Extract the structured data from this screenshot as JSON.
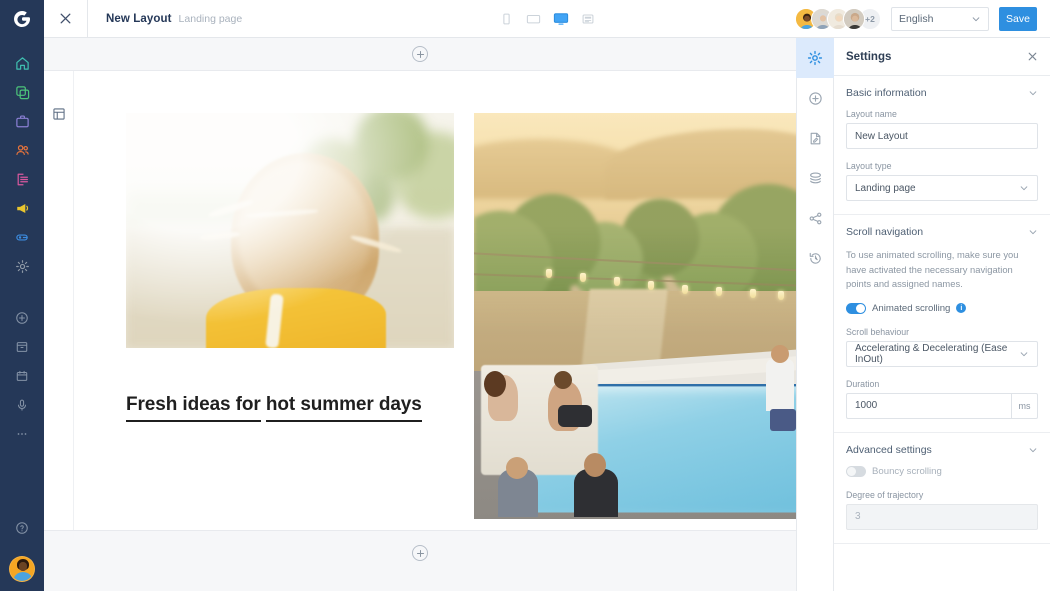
{
  "nav": {
    "logo": "app-logo",
    "items": [
      {
        "name": "home",
        "label": "Home",
        "color": "#3fbfb0"
      },
      {
        "name": "pages",
        "label": "Pages",
        "color": "#4cc47a"
      },
      {
        "name": "projects",
        "label": "Projects",
        "color": "#8a7fd4"
      },
      {
        "name": "contacts",
        "label": "Contacts",
        "color": "#e8743b"
      },
      {
        "name": "forms",
        "label": "Forms",
        "color": "#d9589e"
      },
      {
        "name": "campaigns",
        "label": "Campaigns",
        "color": "#e8c52e"
      },
      {
        "name": "integrations",
        "label": "Integrations",
        "color": "#3c8ce0"
      },
      {
        "name": "settings",
        "label": "Settings",
        "color": "#8e99a6"
      }
    ],
    "tools": [
      {
        "name": "add",
        "label": "Add"
      },
      {
        "name": "archive",
        "label": "Archive"
      },
      {
        "name": "calendar",
        "label": "Calendar"
      },
      {
        "name": "microphone",
        "label": "Voice"
      },
      {
        "name": "more",
        "label": "More"
      }
    ],
    "help_label": "Help",
    "avatar_label": "Account"
  },
  "topbar": {
    "close_label": "Close",
    "title": "New Layout",
    "subtitle": "Landing page",
    "devices": [
      {
        "name": "mobile",
        "label": "Mobile",
        "active": false
      },
      {
        "name": "tablet",
        "label": "Tablet",
        "active": false
      },
      {
        "name": "desktop",
        "label": "Desktop",
        "active": true
      },
      {
        "name": "wide",
        "label": "Wide",
        "active": false
      }
    ],
    "collaborators": [
      {
        "name": "collaborator-1",
        "skin": "#6b4423",
        "hair": "#1d120a",
        "shirt": "#f0a830",
        "bg": "#f4b942"
      },
      {
        "name": "collaborator-2",
        "skin": "#e0c0a6",
        "hair": "#d8d8d8",
        "shirt": "#8fa3b8",
        "bg": "#d8d5cf"
      },
      {
        "name": "collaborator-3",
        "skin": "#f0d6bc",
        "hair": "#e8dcc8",
        "shirt": "#e8e2d6",
        "bg": "#efe8dc"
      },
      {
        "name": "collaborator-4",
        "skin": "#d9b79a",
        "hair": "#c9a88a",
        "shirt": "#3b3a38",
        "bg": "#cfc8bd"
      }
    ],
    "collaborators_overflow": "+2",
    "language": "English",
    "save_label": "Save"
  },
  "canvas": {
    "add_section_top_label": "Add section",
    "add_section_bottom_label": "Add section",
    "layout_icon_label": "Layout grid",
    "blocks": {
      "image_left_alt": "Blonde woman outdoors in yellow top",
      "image_right_alt": "People gathered around a swimming pool at sunset",
      "headline_line1": "Fresh ideas for",
      "headline_line2": "hot summer days"
    }
  },
  "icon_rail": [
    {
      "name": "settings",
      "label": "Settings",
      "active": true
    },
    {
      "name": "add-element",
      "label": "Add element",
      "active": false
    },
    {
      "name": "content",
      "label": "Content",
      "active": false
    },
    {
      "name": "layers",
      "label": "Layers",
      "active": false
    },
    {
      "name": "share",
      "label": "Share",
      "active": false
    },
    {
      "name": "history",
      "label": "History",
      "active": false
    }
  ],
  "settings": {
    "title": "Settings",
    "close_label": "Close settings",
    "sections": {
      "basic": {
        "title": "Basic information",
        "layout_name_label": "Layout name",
        "layout_name_value": "New Layout",
        "layout_type_label": "Layout type",
        "layout_type_value": "Landing page"
      },
      "scroll": {
        "title": "Scroll navigation",
        "description": "To use animated scrolling, make sure you have activated the necessary navigation points and assigned names.",
        "animated_scrolling_label": "Animated scrolling",
        "animated_scrolling_on": true,
        "info_glyph": "i",
        "behaviour_label": "Scroll behaviour",
        "behaviour_value": "Accelerating & Decelerating (Ease InOut)",
        "duration_label": "Duration",
        "duration_value": "1000",
        "duration_unit": "ms"
      },
      "advanced": {
        "title": "Advanced settings",
        "bouncy_scrolling_label": "Bouncy scrolling",
        "bouncy_scrolling_on": false,
        "degree_label": "Degree of trajectory",
        "degree_value": "3"
      }
    }
  },
  "colors": {
    "nav_bg": "#253858",
    "accent": "#2e8fe0",
    "canvas_bg": "#f6f7f9",
    "panel_bg": "#ffffff",
    "active_cell": "#dceafc"
  }
}
